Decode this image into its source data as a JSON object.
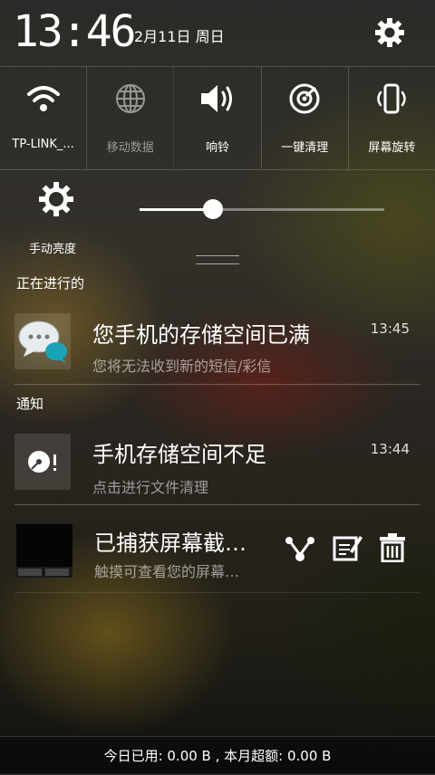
{
  "status": {
    "time": "13:46",
    "date": "2月11日 周日"
  },
  "tiles": [
    {
      "label": "TP-LINK_...",
      "icon": "wifi-icon",
      "active": true
    },
    {
      "label": "移动数据",
      "icon": "globe-icon",
      "active": false
    },
    {
      "label": "响铃",
      "icon": "speaker-icon",
      "active": true
    },
    {
      "label": "一键清理",
      "icon": "clean-icon",
      "active": true
    },
    {
      "label": "屏幕旋转",
      "icon": "rotate-icon",
      "active": true
    }
  ],
  "brightness": {
    "label": "手动亮度",
    "level": 0.3
  },
  "ongoing": {
    "title": "正在进行的",
    "item": {
      "title": "您手机的存储空间已满",
      "subtitle": "您将无法收到新的短信/彩信",
      "time": "13:45",
      "icon": "message-bubble-icon"
    }
  },
  "notices": {
    "title": "通知",
    "storage": {
      "title": "手机存储空间不足",
      "subtitle": "点击进行文件清理",
      "time": "13:44",
      "icon": "disk-alert-icon"
    },
    "screenshot": {
      "title": "已捕获屏幕截…",
      "subtitle": "触摸可查看您的屏幕…",
      "actions": [
        "share-icon",
        "edit-icon",
        "delete-icon"
      ]
    }
  },
  "footer": {
    "data_usage": "今日已用: 0.00 B , 本月超额: 0.00 B"
  },
  "colors": {
    "accent": "#ffffff",
    "teal": "#1aa3b8"
  }
}
